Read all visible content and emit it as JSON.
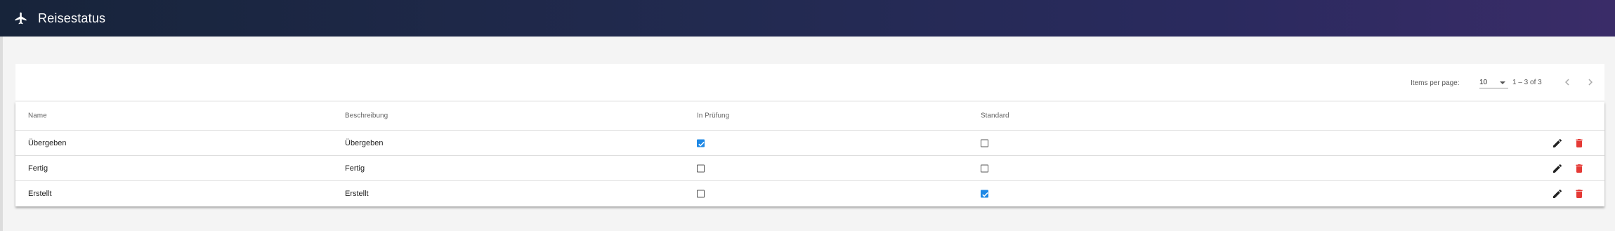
{
  "header": {
    "title": "Reisestatus",
    "icon": "airplane-icon"
  },
  "paginator": {
    "items_per_page_label": "Items per page:",
    "items_per_page_value": "10",
    "range_label": "1 – 3 of 3"
  },
  "table": {
    "columns": {
      "name": "Name",
      "description": "Beschreibung",
      "in_review": "In Prüfung",
      "default": "Standard"
    },
    "rows": [
      {
        "name": "Übergeben",
        "description": "Übergeben",
        "in_review": true,
        "default": false
      },
      {
        "name": "Fertig",
        "description": "Fertig",
        "in_review": false,
        "default": false
      },
      {
        "name": "Erstellt",
        "description": "Erstellt",
        "in_review": false,
        "default": true
      }
    ]
  },
  "colors": {
    "accent": "#1e88e5",
    "delete": "#e53935",
    "edit": "#222222"
  }
}
